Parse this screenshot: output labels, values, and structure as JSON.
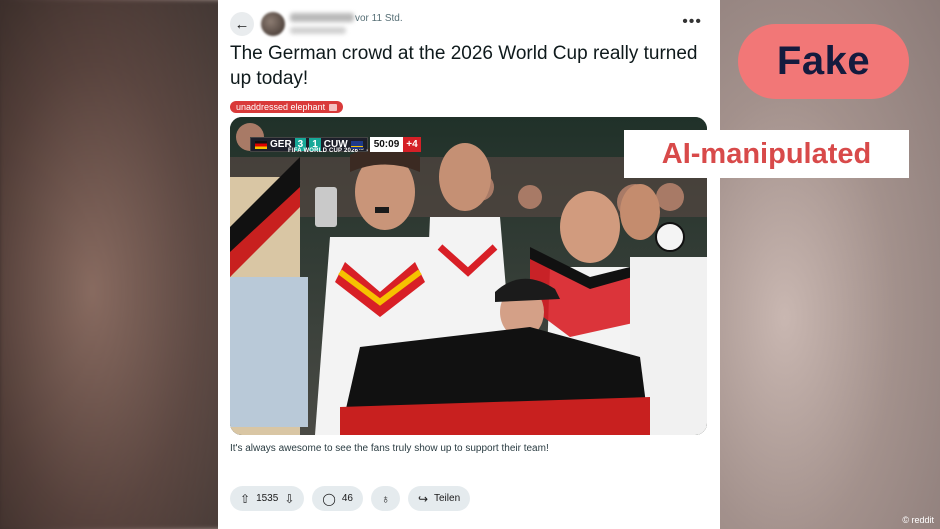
{
  "post": {
    "time_ago": "vor 11 Std.",
    "more_label": "•••",
    "back_icon": "arrow-left-icon",
    "title": "The German crowd at the 2026 World Cup really turned up today!",
    "flair": "unaddressed elephant",
    "caption": "It's always awesome to see the fans truly show up to support their team!"
  },
  "scoreboard": {
    "league": "FIFA WORLD CUP 2026™ - GROUP E",
    "home": "GER",
    "home_score": "3",
    "away_score": "1",
    "away": "CUW",
    "clock": "50:09",
    "added": "+4"
  },
  "actions": {
    "upvotes": "1535",
    "comments": "46",
    "share_label": "Teilen",
    "upvote_icon": "⇧",
    "downvote_icon": "⇩",
    "comment_icon": "◯",
    "award_icon": "♁",
    "share_icon": "↪"
  },
  "overlay": {
    "verdict": "Fake",
    "label": "AI-manipulated",
    "credit": "© reddit"
  },
  "colors": {
    "verdict_bg": "#f27777",
    "verdict_text": "#141b3e",
    "label_text": "#d84a4a",
    "flair_bg": "#d93a3a"
  }
}
